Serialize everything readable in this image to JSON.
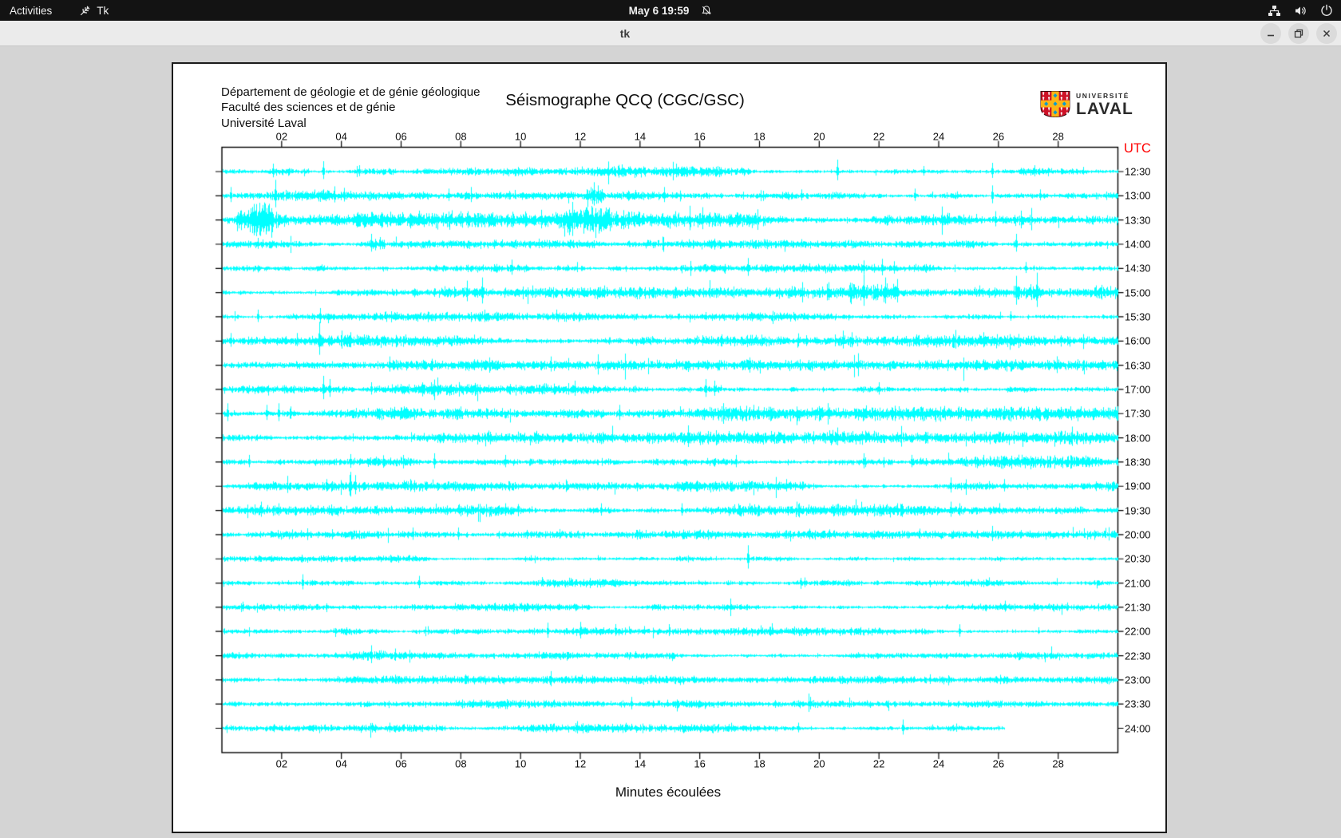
{
  "top_bar": {
    "activities": "Activities",
    "app_name": "Tk",
    "clock": "May 6 19:59"
  },
  "window": {
    "title": "tk"
  },
  "plot": {
    "institution": "Département de géologie et de génie géologique\nFaculté des sciences et de génie\nUniversité Laval",
    "title": "Séismographe QCQ (CGC/GSC)",
    "logo": {
      "top": "UNIVERSITÉ",
      "bottom": "LAVAL"
    },
    "right_axis_title": "UTC",
    "x_axis_title": "Minutes écoulées",
    "colors": {
      "trace": "#00ffff",
      "utc_label": "#ff0000",
      "frame": "#000000",
      "paper": "#ffffff"
    }
  },
  "chart_data": {
    "type": "line",
    "subtype": "seismogram-helicorder",
    "title": "Séismographe QCQ (CGC/GSC)",
    "xlabel": "Minutes écoulées",
    "right_axis_label": "UTC",
    "x_range": [
      0,
      30
    ],
    "x_ticks": [
      "02",
      "04",
      "06",
      "08",
      "10",
      "12",
      "14",
      "16",
      "18",
      "20",
      "22",
      "24",
      "26",
      "28"
    ],
    "trace_color": "#00ffff",
    "traces": [
      {
        "utc": "12:30",
        "noise_amp": 3.0,
        "end_minute": 30,
        "spikes": [
          [
            1.7,
            10
          ],
          [
            3.4,
            13
          ],
          [
            4.6,
            8
          ],
          [
            13.4,
            9
          ],
          [
            15.2,
            10
          ],
          [
            20.6,
            15
          ],
          [
            23.5,
            7
          ],
          [
            25.8,
            11
          ],
          [
            27.2,
            8
          ]
        ],
        "bursts": []
      },
      {
        "utc": "13:00",
        "noise_amp": 3.2,
        "end_minute": 30,
        "spikes": [
          [
            0.3,
            11
          ],
          [
            1.8,
            20
          ],
          [
            4.1,
            10
          ],
          [
            7.6,
            9
          ],
          [
            12.45,
            17
          ],
          [
            12.6,
            13
          ],
          [
            14.8,
            11
          ],
          [
            19.4,
            8
          ],
          [
            23.2,
            9
          ],
          [
            25.8,
            13
          ],
          [
            27.4,
            8
          ]
        ],
        "bursts": [
          [
            12.5,
            0.6,
            2.2
          ]
        ]
      },
      {
        "utc": "13:30",
        "noise_amp": 4.4,
        "end_minute": 30,
        "spikes": [
          [
            1.25,
            18
          ],
          [
            1.5,
            15
          ],
          [
            5.0,
            10
          ],
          [
            8.0,
            11
          ],
          [
            12.0,
            13
          ],
          [
            13.2,
            11
          ],
          [
            16.1,
            16
          ],
          [
            24.3,
            9
          ],
          [
            25.9,
            11
          ]
        ],
        "bursts": [
          [
            1.1,
            1.2,
            2.0
          ],
          [
            12.2,
            1.6,
            1.8
          ]
        ]
      },
      {
        "utc": "14:00",
        "noise_amp": 2.4,
        "end_minute": 30,
        "spikes": [
          [
            1.2,
            8
          ],
          [
            5.0,
            13
          ],
          [
            5.3,
            9
          ],
          [
            10.6,
            7
          ],
          [
            26.6,
            13
          ]
        ],
        "bursts": [
          [
            5.1,
            0.7,
            2.2
          ]
        ]
      },
      {
        "utc": "14:30",
        "noise_amp": 2.9,
        "end_minute": 30,
        "spikes": [
          [
            9.7,
            11
          ],
          [
            17.6,
            13
          ],
          [
            21.5,
            10
          ],
          [
            22.1,
            12
          ],
          [
            22.5,
            9
          ],
          [
            26.9,
            8
          ]
        ],
        "bursts": []
      },
      {
        "utc": "15:00",
        "noise_amp": 2.9,
        "end_minute": 30,
        "spikes": [
          [
            8.2,
            15
          ],
          [
            8.7,
            19
          ],
          [
            10.4,
            9
          ],
          [
            12.8,
            9
          ],
          [
            20.3,
            13
          ],
          [
            21.5,
            23
          ],
          [
            22.2,
            19
          ],
          [
            22.6,
            17
          ],
          [
            26.6,
            21
          ],
          [
            27.3,
            25
          ]
        ],
        "bursts": [
          [
            21.8,
            1.6,
            1.8
          ],
          [
            27.0,
            1.0,
            1.6
          ]
        ]
      },
      {
        "utc": "15:30",
        "noise_amp": 2.5,
        "end_minute": 30,
        "spikes": [
          [
            1.2,
            9
          ],
          [
            3.3,
            11
          ],
          [
            8.8,
            9
          ],
          [
            16.2,
            6
          ],
          [
            26.4,
            7
          ]
        ],
        "bursts": []
      },
      {
        "utc": "16:00",
        "noise_amp": 3.3,
        "end_minute": 30,
        "spikes": [
          [
            0.3,
            10
          ],
          [
            3.25,
            24
          ],
          [
            4.3,
            11
          ],
          [
            19.3,
            9
          ],
          [
            20.8,
            13
          ],
          [
            21.1,
            11
          ],
          [
            25.5,
            11
          ]
        ],
        "bursts": [
          [
            20.9,
            0.8,
            1.7
          ]
        ]
      },
      {
        "utc": "16:30",
        "noise_amp": 2.9,
        "end_minute": 30,
        "spikes": [
          [
            5.6,
            11
          ],
          [
            11.0,
            11
          ],
          [
            11.6,
            9
          ],
          [
            21.3,
            8
          ],
          [
            24.0,
            7
          ]
        ],
        "bursts": []
      },
      {
        "utc": "17:00",
        "noise_amp": 3.3,
        "end_minute": 30,
        "spikes": [
          [
            3.4,
            17
          ],
          [
            3.6,
            13
          ],
          [
            5.0,
            9
          ],
          [
            7.0,
            9
          ],
          [
            11.8,
            11
          ],
          [
            16.2,
            13
          ],
          [
            16.5,
            11
          ],
          [
            22.0,
            9
          ]
        ],
        "bursts": [
          [
            16.3,
            0.9,
            1.8
          ]
        ]
      },
      {
        "utc": "17:30",
        "noise_amp": 3.7,
        "end_minute": 30,
        "spikes": [
          [
            0.2,
            13
          ],
          [
            1.5,
            11
          ],
          [
            1.9,
            13
          ],
          [
            2.3,
            9
          ],
          [
            8.0,
            9
          ],
          [
            13.3,
            11
          ],
          [
            17.8,
            11
          ],
          [
            17.95,
            9
          ]
        ],
        "bursts": []
      },
      {
        "utc": "18:00",
        "noise_amp": 3.5,
        "end_minute": 30,
        "spikes": [
          [
            20.6,
            13
          ],
          [
            26.0,
            8
          ]
        ],
        "bursts": []
      },
      {
        "utc": "18:30",
        "noise_amp": 3.3,
        "end_minute": 30,
        "spikes": [
          [
            0.9,
            9
          ],
          [
            4.3,
            10
          ],
          [
            7.1,
            11
          ],
          [
            9.5,
            9
          ],
          [
            17.2,
            9
          ],
          [
            21.5,
            11
          ],
          [
            23.1,
            9
          ],
          [
            25.5,
            9
          ]
        ],
        "bursts": []
      },
      {
        "utc": "19:00",
        "noise_amp": 2.9,
        "end_minute": 30,
        "spikes": [
          [
            3.5,
            9
          ],
          [
            4.3,
            18
          ],
          [
            4.45,
            14
          ],
          [
            6.3,
            9
          ],
          [
            18.9,
            9
          ],
          [
            24.4,
            11
          ],
          [
            26.2,
            9
          ]
        ],
        "bursts": []
      },
      {
        "utc": "19:30",
        "noise_amp": 3.3,
        "end_minute": 30,
        "spikes": [
          [
            1.3,
            11
          ],
          [
            1.9,
            9
          ],
          [
            9.5,
            9
          ],
          [
            12.7,
            9
          ],
          [
            15.4,
            9
          ],
          [
            22.6,
            9
          ],
          [
            24.4,
            11
          ],
          [
            24.7,
            9
          ]
        ],
        "bursts": []
      },
      {
        "utc": "20:00",
        "noise_amp": 2.9,
        "end_minute": 30,
        "spikes": [
          [
            6.4,
            9
          ],
          [
            7.9,
            9
          ],
          [
            11.3,
            7
          ],
          [
            25.8,
            11
          ]
        ],
        "bursts": []
      },
      {
        "utc": "20:30",
        "noise_amp": 2.5,
        "end_minute": 30,
        "spikes": [
          [
            17.6,
            17
          ]
        ],
        "bursts": []
      },
      {
        "utc": "21:00",
        "noise_amp": 2.7,
        "end_minute": 30,
        "spikes": [
          [
            2.7,
            11
          ],
          [
            6.6,
            9
          ],
          [
            19.5,
            7
          ]
        ],
        "bursts": []
      },
      {
        "utc": "21:30",
        "noise_amp": 2.5,
        "end_minute": 30,
        "spikes": [
          [
            0.7,
            7
          ]
        ],
        "bursts": []
      },
      {
        "utc": "22:00",
        "noise_amp": 2.5,
        "end_minute": 30,
        "spikes": [
          [
            10.9,
            11
          ],
          [
            24.7,
            9
          ]
        ],
        "bursts": []
      },
      {
        "utc": "22:30",
        "noise_amp": 2.5,
        "end_minute": 30,
        "spikes": [
          [
            5.0,
            13
          ],
          [
            5.8,
            9
          ]
        ],
        "bursts": []
      },
      {
        "utc": "23:00",
        "noise_amp": 2.3,
        "end_minute": 30,
        "spikes": [
          [
            11.0,
            11
          ],
          [
            23.7,
            7
          ]
        ],
        "bursts": []
      },
      {
        "utc": "23:30",
        "noise_amp": 2.3,
        "end_minute": 30,
        "spikes": [
          [
            13.7,
            9
          ],
          [
            19.7,
            9
          ]
        ],
        "bursts": []
      },
      {
        "utc": "24:00",
        "noise_amp": 2.3,
        "end_minute": 26.2,
        "spikes": [
          [
            5.6,
            7
          ],
          [
            11.9,
            9
          ],
          [
            19.3,
            7
          ],
          [
            22.8,
            11
          ]
        ],
        "bursts": []
      }
    ]
  }
}
